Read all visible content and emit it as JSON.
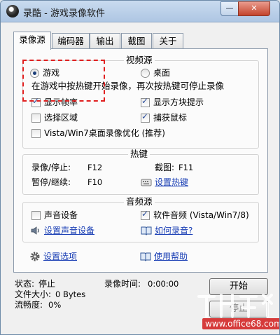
{
  "window": {
    "title": "录酷 - 游戏录像软件",
    "minimize_glyph": "—",
    "close_glyph": "✕"
  },
  "tabs": [
    {
      "label": "录像源",
      "active": true
    },
    {
      "label": "编码器"
    },
    {
      "label": "输出"
    },
    {
      "label": "截图"
    },
    {
      "label": "关于"
    }
  ],
  "video_source": {
    "legend": "视频源",
    "radio_game": "游戏",
    "radio_desktop": "桌面",
    "selected": "game",
    "hint": "在游戏中按热键开始录像，再次按热键可停止录像",
    "options": {
      "show_fps": {
        "label": "显示帧率",
        "checked": true
      },
      "show_block_hint": {
        "label": "显示方块提示",
        "checked": true
      },
      "select_region": {
        "label": "选择区域",
        "checked": false
      },
      "capture_mouse": {
        "label": "捕获鼠标",
        "checked": true
      },
      "vista_optimize": {
        "label": "Vista/Win7桌面录像优化 (推荐)",
        "checked": false
      }
    }
  },
  "hotkeys": {
    "legend": "热键",
    "record_stop_label": "录像/停止:",
    "record_stop_value": "F12",
    "screenshot_label": "截图:",
    "screenshot_value": "F11",
    "pause_resume_label": "暂停/继续:",
    "pause_resume_value": "F10",
    "set_hotkey_link": "设置热键"
  },
  "audio_source": {
    "legend": "音频源",
    "sound_device": {
      "label": "声音设备",
      "checked": false
    },
    "software_audio": {
      "label": "软件音频 (Vista/Win7/8)",
      "checked": true
    },
    "set_sound_device_link": "设置声音设备",
    "how_to_record_link": "如何录音?"
  },
  "bottom_links": {
    "settings": "设置选项",
    "help": "使用帮助"
  },
  "status": {
    "state_label": "状态:",
    "state_value": "停止",
    "time_label": "录像时间:",
    "time_value": "0:00:00",
    "filesize_label": "文件大小:",
    "filesize_value": "0 Bytes",
    "smoothness_label": "流畅度:",
    "smoothness_value": "0%"
  },
  "buttons": {
    "start": "开始",
    "stop": "停止"
  },
  "watermark": {
    "text": "www.office68.com"
  },
  "colors": {
    "link": "#1a3fb5",
    "annotation": "#e02020",
    "titlebar": "#aec6e3"
  }
}
